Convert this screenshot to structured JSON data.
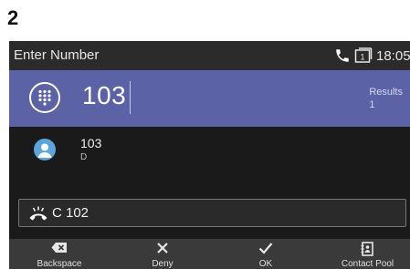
{
  "step": "2",
  "header": {
    "title": "Enter Number",
    "time": "18:05",
    "icons": [
      "phone-icon",
      "line-box-icon"
    ]
  },
  "entry": {
    "number": "103",
    "results_label": "Results",
    "results_count": "1",
    "accent_color": "#5b62a5"
  },
  "result": {
    "name": "103",
    "detail": "D",
    "icon": "contact-icon"
  },
  "held_call": {
    "label": "C 102",
    "icon": "hangup-handset-icon"
  },
  "softkeys": [
    {
      "label": "Backspace",
      "icon": "backspace-icon"
    },
    {
      "label": "Deny",
      "icon": "close-icon"
    },
    {
      "label": "OK",
      "icon": "check-icon"
    },
    {
      "label": "Contact Pool",
      "icon": "contact-book-icon"
    }
  ]
}
